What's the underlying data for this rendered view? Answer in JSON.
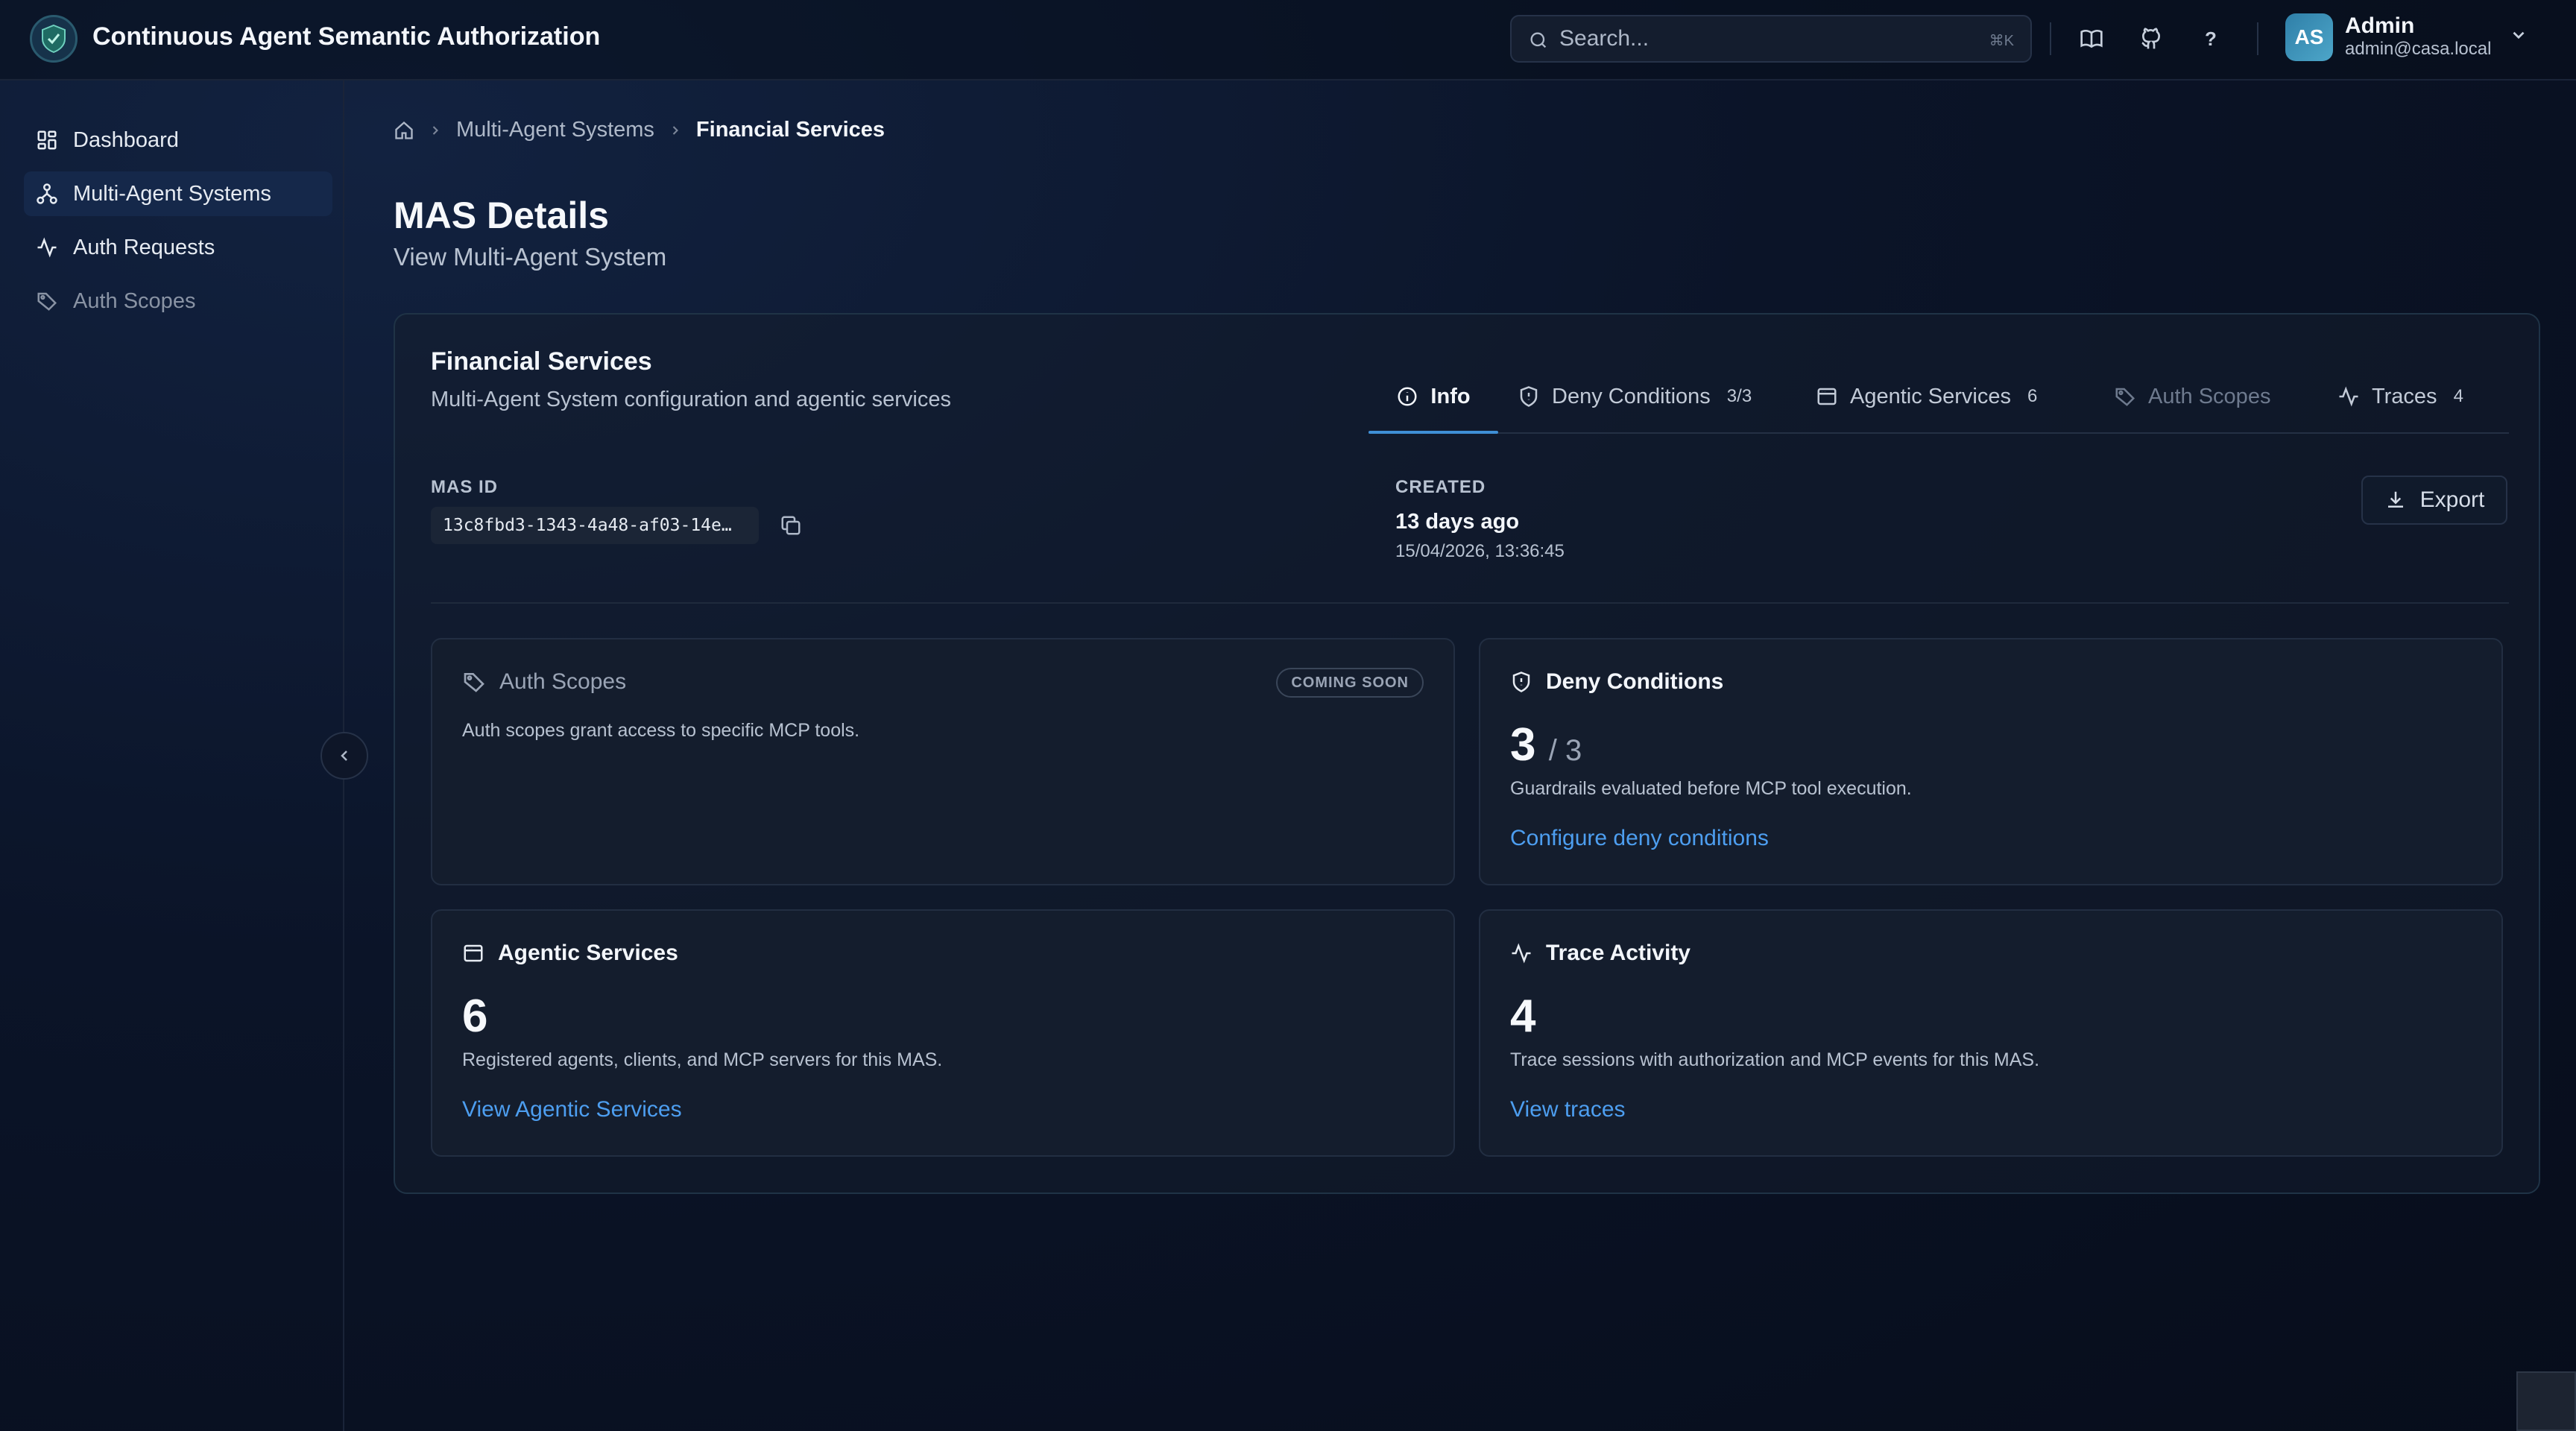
{
  "app": {
    "title": "Continuous Agent Semantic Authorization"
  },
  "search": {
    "placeholder": "Search...",
    "shortcut": "⌘K"
  },
  "user": {
    "initials": "AS",
    "name": "Admin",
    "email": "admin@casa.local"
  },
  "sidebar": {
    "items": [
      {
        "label": "Dashboard",
        "icon": "grid-icon"
      },
      {
        "label": "Multi-Agent Systems",
        "icon": "network-icon",
        "active": true
      },
      {
        "label": "Auth Requests",
        "icon": "activity-icon"
      },
      {
        "label": "Auth Scopes",
        "icon": "tag-icon",
        "muted": true
      }
    ]
  },
  "breadcrumb": {
    "items": [
      "Multi-Agent Systems",
      "Financial Services"
    ]
  },
  "page": {
    "title": "MAS Details",
    "subtitle": "View Multi-Agent System"
  },
  "mas": {
    "name": "Financial Services",
    "description": "Multi-Agent System configuration and agentic services",
    "id_label": "MAS ID",
    "id_value": "13c8fbd3-1343-4a48-af03-14e…",
    "created_label": "CREATED",
    "created_relative": "13 days ago",
    "created_absolute": "15/04/2026, 13:36:45",
    "export_label": "Export"
  },
  "tabs": [
    {
      "label": "Info",
      "count": "",
      "active": true
    },
    {
      "label": "Deny Conditions",
      "count": "3/3"
    },
    {
      "label": "Agentic Services",
      "count": "6"
    },
    {
      "label": "Auth Scopes",
      "count": "",
      "muted": true
    },
    {
      "label": "Traces",
      "count": "4"
    }
  ],
  "panels": {
    "auth_scopes": {
      "title": "Auth Scopes",
      "badge": "COMING SOON",
      "text": "Auth scopes grant access to specific MCP tools."
    },
    "deny_conditions": {
      "title": "Deny Conditions",
      "value": "3",
      "total": "/ 3",
      "text": "Guardrails evaluated before MCP tool execution.",
      "link": "Configure deny conditions"
    },
    "agentic_services": {
      "title": "Agentic Services",
      "value": "6",
      "text": "Registered agents, clients, and MCP servers for this MAS.",
      "link": "View Agentic Services"
    },
    "trace_activity": {
      "title": "Trace Activity",
      "value": "4",
      "text": "Trace sessions with authorization and MCP events for this MAS.",
      "link": "View traces"
    }
  },
  "colors": {
    "accent": "#3f8fd6",
    "link": "#4d9ef0",
    "background": "#0b1428"
  }
}
